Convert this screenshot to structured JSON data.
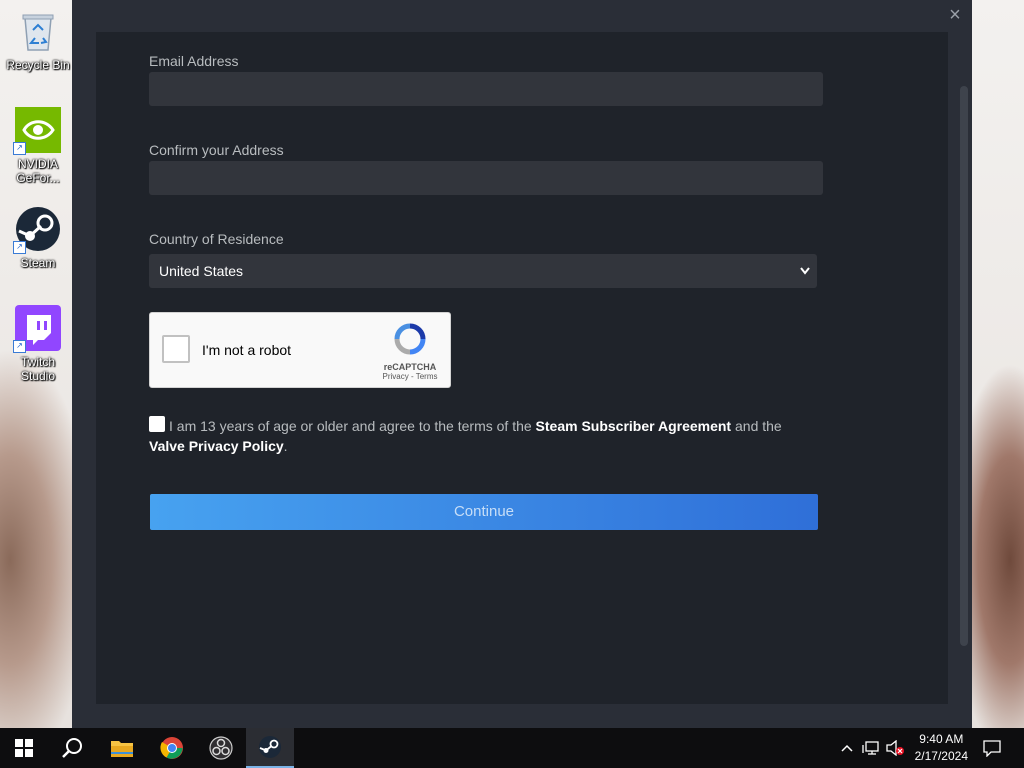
{
  "desktop": {
    "icons": [
      {
        "label": "Recycle Bin"
      },
      {
        "label": "NVIDIA GeFor..."
      },
      {
        "label": "Steam"
      },
      {
        "label": "Twitch Studio"
      }
    ]
  },
  "form": {
    "email_label": "Email Address",
    "email_value": "",
    "confirm_label": "Confirm your Address",
    "confirm_value": "",
    "country_label": "Country of Residence",
    "country_selected": "United States",
    "captcha": {
      "text": "I'm not a robot",
      "brand": "reCAPTCHA",
      "links": "Privacy - Terms"
    },
    "agree": {
      "prefix": "I am 13 years of age or older and agree to the terms of the ",
      "ssa_link": "Steam Subscriber Agreement",
      "middle": " and the",
      "vpp_link": "Valve Privacy Policy",
      "suffix": "."
    },
    "continue_label": "Continue"
  },
  "taskbar": {
    "time": "9:40 AM",
    "date": "2/17/2024"
  },
  "colors": {
    "window_bg": "#2a2e37",
    "panel_bg": "#1f232a",
    "input_bg": "#32353c",
    "button_start": "#47a2f0",
    "button_end": "#2f6fd8"
  }
}
